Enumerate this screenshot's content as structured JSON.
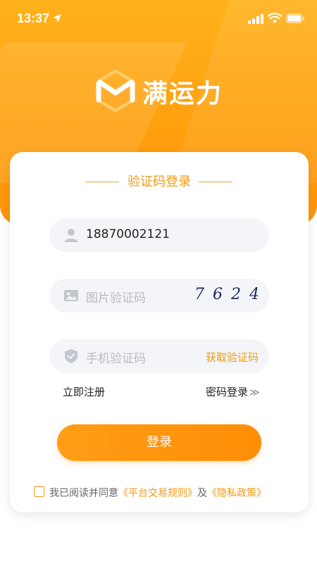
{
  "status_bar": {
    "time": "13:37"
  },
  "brand": {
    "name": "满运力"
  },
  "card": {
    "title": "验证码登录",
    "phone_value": "18870002121",
    "captcha_placeholder": "图片验证码",
    "captcha_code": "7624",
    "sms_placeholder": "手机验证码",
    "get_code_label": "获取验证码",
    "register_link": "立即注册",
    "password_login_link": "密码登录",
    "login_button": "登录",
    "agreement_prefix": "我已阅读并同意",
    "agreement_rules": "《平台交易规则》",
    "agreement_and": "及",
    "agreement_privacy": "《隐私政策》"
  },
  "colors": {
    "brand": "#ff9a0f",
    "accent_text": "#f29a13",
    "field_bg": "#f3f5f8"
  },
  "icons": {
    "status": [
      "location-arrow-icon",
      "signal-icon",
      "wifi-icon",
      "battery-icon"
    ],
    "fields": [
      "user-icon",
      "image-icon",
      "shield-icon"
    ],
    "logo": "hexagon-m-logo"
  }
}
